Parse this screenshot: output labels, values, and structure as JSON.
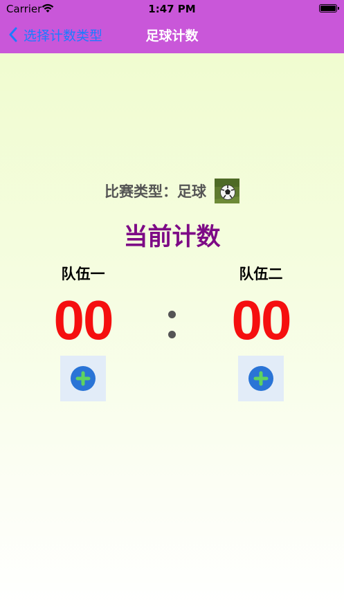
{
  "status_bar": {
    "carrier": "Carrier",
    "time": "1:47 PM"
  },
  "nav": {
    "back_label": "选择计数类型",
    "title": "足球计数"
  },
  "match": {
    "type_label": "比赛类型：足球"
  },
  "counter": {
    "title": "当前计数"
  },
  "teams": [
    {
      "name": "队伍一",
      "score": "00"
    },
    {
      "name": "队伍二",
      "score": "00"
    }
  ],
  "colors": {
    "nav_bg": "#c957d9",
    "back_blue": "#1b7cff",
    "score_red": "#f50f0f",
    "title_purple": "#7d0a86",
    "add_green": "#5fd35f",
    "add_blue": "#2a74d6"
  },
  "icons": {
    "back": "chevron-left-icon",
    "ball": "soccer-ball-icon",
    "add": "plus-circle-icon",
    "wifi": "wifi-icon",
    "battery": "battery-icon"
  }
}
